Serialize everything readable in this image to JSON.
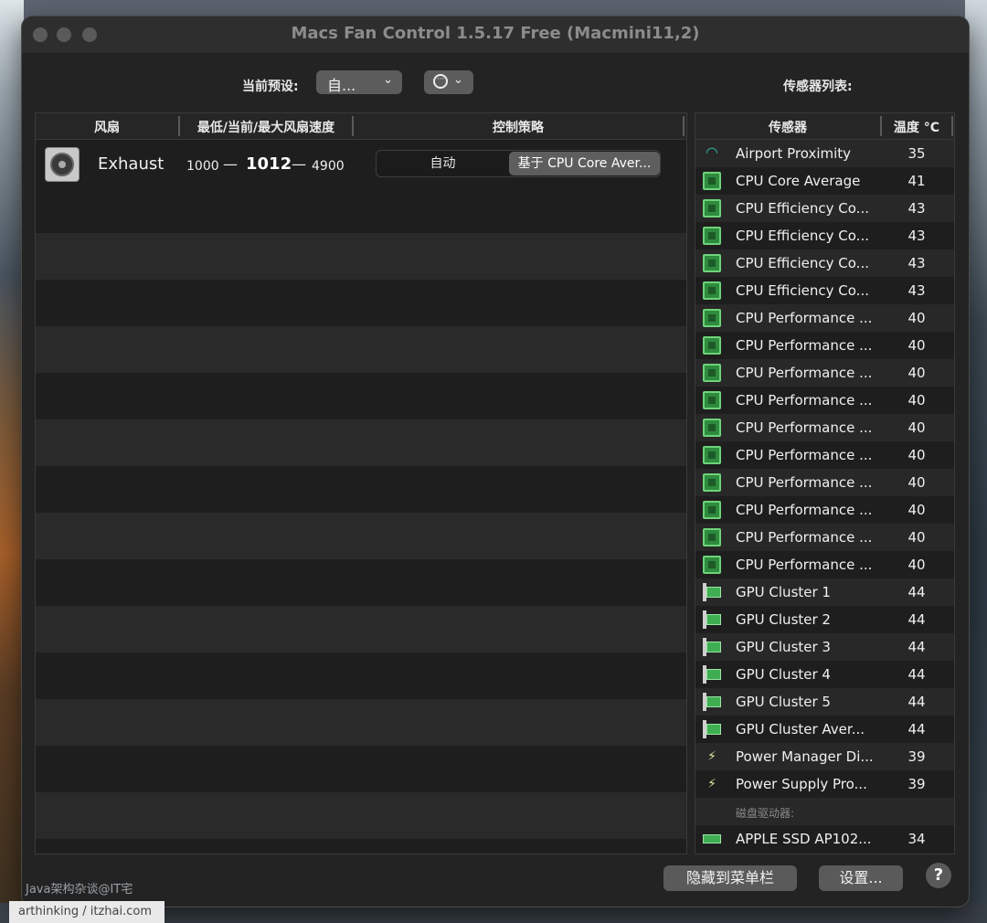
{
  "window": {
    "title": "Macs Fan Control 1.5.17 Free (Macmini11,2)"
  },
  "toolbar": {
    "preset_label": "当前预设:",
    "preset_value": "自...",
    "sensor_list_label": "传感器列表:"
  },
  "fan_table": {
    "headers": [
      "风扇",
      "最低/当前/最大风扇速度",
      "控制策略"
    ],
    "fans": [
      {
        "name": "Exhaust",
        "min": "1000",
        "current": "1012",
        "max": "4900",
        "mode_auto": "自动",
        "mode_sensor": "基于 CPU Core Aver..."
      }
    ]
  },
  "sensor_table": {
    "headers": [
      "传感器",
      "温度 °C"
    ],
    "rows": [
      {
        "icon": "wifi-icon",
        "name": "Airport Proximity",
        "temp": "35"
      },
      {
        "icon": "cpu-icon",
        "name": "CPU Core Average",
        "temp": "41"
      },
      {
        "icon": "cpu-icon",
        "name": "CPU Efficiency Co...",
        "temp": "43"
      },
      {
        "icon": "cpu-icon",
        "name": "CPU Efficiency Co...",
        "temp": "43"
      },
      {
        "icon": "cpu-icon",
        "name": "CPU Efficiency Co...",
        "temp": "43"
      },
      {
        "icon": "cpu-icon",
        "name": "CPU Efficiency Co...",
        "temp": "43"
      },
      {
        "icon": "cpu-icon",
        "name": "CPU Performance ...",
        "temp": "40"
      },
      {
        "icon": "cpu-icon",
        "name": "CPU Performance ...",
        "temp": "40"
      },
      {
        "icon": "cpu-icon",
        "name": "CPU Performance ...",
        "temp": "40"
      },
      {
        "icon": "cpu-icon",
        "name": "CPU Performance ...",
        "temp": "40"
      },
      {
        "icon": "cpu-icon",
        "name": "CPU Performance ...",
        "temp": "40"
      },
      {
        "icon": "cpu-icon",
        "name": "CPU Performance ...",
        "temp": "40"
      },
      {
        "icon": "cpu-icon",
        "name": "CPU Performance ...",
        "temp": "40"
      },
      {
        "icon": "cpu-icon",
        "name": "CPU Performance ...",
        "temp": "40"
      },
      {
        "icon": "cpu-icon",
        "name": "CPU Performance ...",
        "temp": "40"
      },
      {
        "icon": "cpu-icon",
        "name": "CPU Performance ...",
        "temp": "40"
      },
      {
        "icon": "gpu-icon",
        "name": "GPU Cluster 1",
        "temp": "44"
      },
      {
        "icon": "gpu-icon",
        "name": "GPU Cluster 2",
        "temp": "44"
      },
      {
        "icon": "gpu-icon",
        "name": "GPU Cluster 3",
        "temp": "44"
      },
      {
        "icon": "gpu-icon",
        "name": "GPU Cluster 4",
        "temp": "44"
      },
      {
        "icon": "gpu-icon",
        "name": "GPU Cluster 5",
        "temp": "44"
      },
      {
        "icon": "gpu-icon",
        "name": "GPU Cluster Aver...",
        "temp": "44"
      },
      {
        "icon": "bolt-icon",
        "name": "Power Manager Di...",
        "temp": "39"
      },
      {
        "icon": "bolt-icon",
        "name": "Power Supply Pro...",
        "temp": "39"
      }
    ],
    "disk_group_label": "磁盘驱动器:",
    "disks": [
      {
        "icon": "ssd-icon",
        "name": "APPLE SSD AP102...",
        "temp": "34"
      }
    ]
  },
  "footer": {
    "hide_button": "隐藏到菜单栏",
    "settings_button": "设置...",
    "help_button": "?"
  },
  "watermark": {
    "line1": "Java架构杂谈@IT宅",
    "line2": "arthinking / itzhai.com"
  }
}
